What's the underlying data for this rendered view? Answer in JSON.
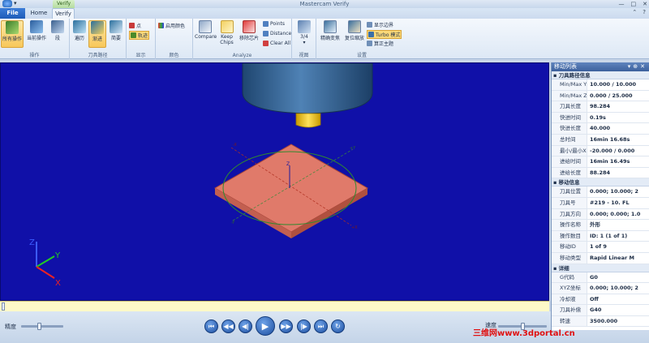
{
  "window": {
    "title": "Mastercam Verify",
    "context_tab": "Verify"
  },
  "tabs": [
    {
      "label": "File"
    },
    {
      "label": "Home"
    },
    {
      "label": "Verify"
    }
  ],
  "ribbon": {
    "groups": [
      {
        "label": "操作",
        "buttons": [
          "所有操作",
          "当前操作",
          "段"
        ]
      },
      {
        "label": "刀具路径",
        "buttons": [
          "遍历",
          "渐进",
          "简要"
        ]
      },
      {
        "label": "显示",
        "buttons": [
          "点",
          "轨迹"
        ]
      },
      {
        "label": "颜色",
        "buttons": [
          "启用颜色"
        ]
      },
      {
        "label": "Analyze",
        "buttons": [
          "Compare",
          "Keep Chips",
          "移除芯片"
        ],
        "small": [
          "Points",
          "Distance",
          "Clear All"
        ]
      },
      {
        "label": "视图",
        "buttons": [
          "3/4"
        ]
      },
      {
        "label": "设置",
        "buttons": [
          "精确变焦",
          "复位缩放"
        ],
        "small": [
          "显示边界",
          "Turbo 模式",
          "算正主题"
        ]
      }
    ]
  },
  "viewport": {
    "background": "#1010a8",
    "stock_color": "#e07a6a",
    "tool_color": "#2f5d8c",
    "holder_color": "#f5c400",
    "axes": {
      "x": "X",
      "y": "Y",
      "z": "Z"
    }
  },
  "controls": {
    "precision_label": "精度",
    "speed_label": "速度",
    "buttons": [
      "first",
      "prev-op",
      "step-back",
      "play",
      "step-forward",
      "next-op",
      "last",
      "loop"
    ]
  },
  "panel": {
    "title": "移动列表",
    "sections": [
      {
        "title": "刀具路径信息",
        "rows": [
          {
            "k": "Min/Max Y",
            "v": "10.000 / 10.000"
          },
          {
            "k": "Min/Max Z",
            "v": "0.000 / 25.000"
          },
          {
            "k": "刀具长度",
            "v": "98.284"
          },
          {
            "k": "快进时间",
            "v": "0.19s"
          },
          {
            "k": "快进长度",
            "v": "40.000"
          },
          {
            "k": "总时间",
            "v": "16min 16.68s"
          },
          {
            "k": "最小/最小X",
            "v": "-20.000 / 0.000"
          },
          {
            "k": "进给时间",
            "v": "16min 16.49s"
          },
          {
            "k": "进给长度",
            "v": "88.284"
          }
        ]
      },
      {
        "title": "移动信息",
        "rows": [
          {
            "k": "刀具位置",
            "v": "0.000; 10.000; 2"
          },
          {
            "k": "刀具号",
            "v": "#219 -    10. FL"
          },
          {
            "k": "刀具方向",
            "v": "0.000; 0.000; 1.0"
          },
          {
            "k": "操作名称",
            "v": "外形"
          },
          {
            "k": "操作数目",
            "v": "ID: 1 (1 of 1)"
          },
          {
            "k": "移动ID",
            "v": "1 of 9"
          },
          {
            "k": "移动类型",
            "v": "Rapid Linear M"
          }
        ]
      },
      {
        "title": "详细",
        "rows": [
          {
            "k": "G代码",
            "v": "G0"
          },
          {
            "k": "XYZ坐标",
            "v": "0.000; 10.000; 2"
          },
          {
            "k": "冷却液",
            "v": "Off"
          },
          {
            "k": "刀具补偿",
            "v": "G40"
          },
          {
            "k": "转速",
            "v": "3500.000"
          }
        ]
      }
    ]
  },
  "watermark": "三维网www.3dportal.cn"
}
